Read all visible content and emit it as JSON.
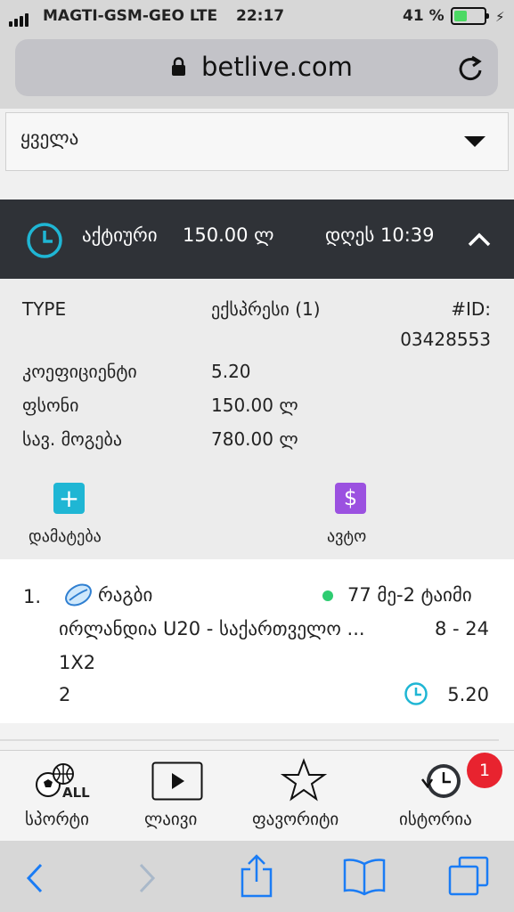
{
  "status_bar": {
    "carrier": "MAGTI-GSM-GEO",
    "network": "LTE",
    "time": "22:17",
    "battery": "41 %"
  },
  "browser": {
    "url": "betlive.com"
  },
  "filter": {
    "selected": "ყველა"
  },
  "bet_header": {
    "status": "აქტიური",
    "amount": "150.00 ლ",
    "date_time": "დღეს 10:39"
  },
  "bet_details": {
    "type_label": "TYPE",
    "type_value": "ექსპრესი (1)",
    "id_label": "#ID:",
    "id_value": "03428553",
    "rows": [
      {
        "label": "კოეფიციენტი",
        "value": "5.20"
      },
      {
        "label": "ფსონი",
        "value": "150.00 ლ"
      },
      {
        "label": "სავ. მოგება",
        "value": "780.00 ლ"
      }
    ],
    "actions": {
      "add_label": "დამატება",
      "auto_label": "ავტო"
    }
  },
  "selection": {
    "index": "1.",
    "sport": "რაგბი",
    "live_status": "77 მე-2 ტაიმი",
    "match": "ირლანდია U20 - საქართველო ...",
    "score": "8 - 24",
    "market": "1X2",
    "pick": "2",
    "odds": "5.20"
  },
  "app_nav": {
    "items": [
      {
        "label": "სპორტი",
        "icon": "sports-all-icon",
        "icon_text": "ALL"
      },
      {
        "label": "ლაივი",
        "icon": "play-icon"
      },
      {
        "label": "ფავორიტი",
        "icon": "star-icon"
      },
      {
        "label": "ისტორია",
        "icon": "history-icon"
      }
    ],
    "history_badge": "1"
  },
  "colors": {
    "accent_cyan": "#1fb6d4",
    "auto_purple": "#9b51e0",
    "live_green": "#2ecc71",
    "badge_red": "#e8232f",
    "header_dark": "#2f3237"
  }
}
